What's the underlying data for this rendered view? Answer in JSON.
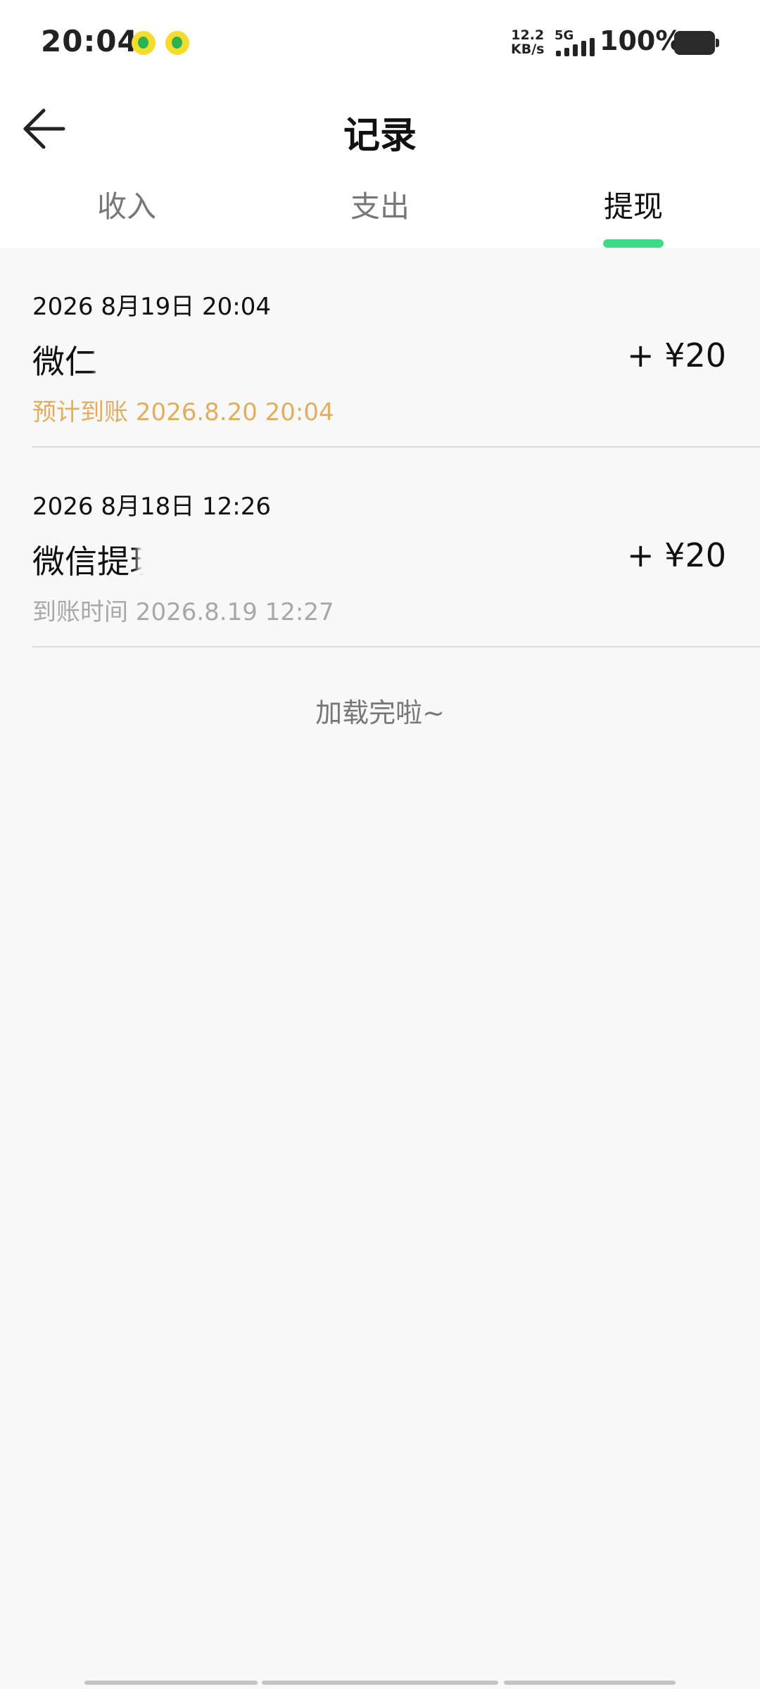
{
  "status_bar": {
    "time": "20:04",
    "speed_value": "12.2",
    "speed_unit": "KB/s",
    "network": "5G",
    "battery": "100%",
    "icons": [
      "app-notification-icon",
      "app-notification-icon",
      "signal-icon",
      "battery-icon"
    ]
  },
  "header": {
    "title": "记录",
    "back_icon": "arrow-left-icon"
  },
  "tabs": [
    {
      "label": "收入",
      "active": false
    },
    {
      "label": "支出",
      "active": false
    },
    {
      "label": "提现",
      "active": true
    }
  ],
  "records": [
    {
      "date": "2026 8月19日 20:04",
      "title": "微仁",
      "amount": "+ ¥20",
      "sub": "预计到账 2026.8.20 20:04",
      "status": "pending"
    },
    {
      "date": "2026 8月18日 12:26",
      "title": "微信提现",
      "amount": "+ ¥20",
      "sub": "到账时间 2026.8.19 12:27",
      "status": "done"
    }
  ],
  "footer": {
    "load_done": "加载完啦~"
  },
  "colors": {
    "accent": "#3ddc84",
    "pending": "#e0ae5e",
    "muted": "#a8a8a8",
    "background": "#f8f8f8"
  }
}
